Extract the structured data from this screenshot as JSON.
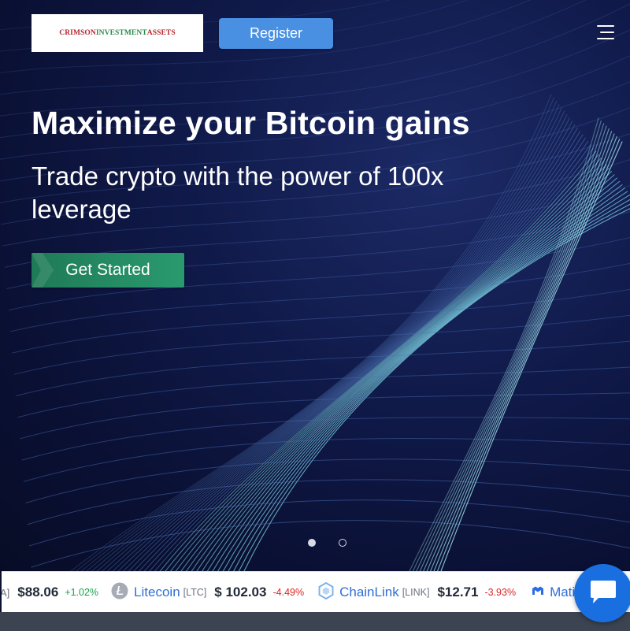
{
  "header": {
    "logo_words": [
      "CRIMSON",
      "INVESTMENT",
      "ASSETS"
    ],
    "register_label": "Register",
    "menu_icon": "hamburger-icon"
  },
  "hero": {
    "headline": "Maximize your Bitcoin gains",
    "subheadline": "Trade crypto with the power of 100x leverage",
    "cta_label": "Get Started",
    "slider": {
      "slides": 2,
      "active_index": 0
    }
  },
  "ticker": {
    "leading_fragment": "A]",
    "leading_price": "$88.06",
    "leading_change": "+1.02%",
    "items": [
      {
        "name": "Litecoin",
        "symbol": "[LTC]",
        "price": "$ 102.03",
        "change": "-4.49%",
        "icon": "litecoin-icon"
      },
      {
        "name": "ChainLink",
        "symbol": "[LINK]",
        "price": "$12.71",
        "change": "-3.93%",
        "icon": "chainlink-icon"
      },
      {
        "name": "Matic",
        "symbol": "",
        "price": "",
        "change": "",
        "icon": "matic-icon"
      }
    ]
  },
  "chat": {
    "icon": "chat-bubble-icon"
  },
  "colors": {
    "register_bg": "#4a90e2",
    "cta_bg": "#2a9a6e",
    "hero_bg": "#0a1033",
    "positive": "#16a34a",
    "negative": "#dc2626",
    "chat_bg": "#1a6fe0"
  }
}
